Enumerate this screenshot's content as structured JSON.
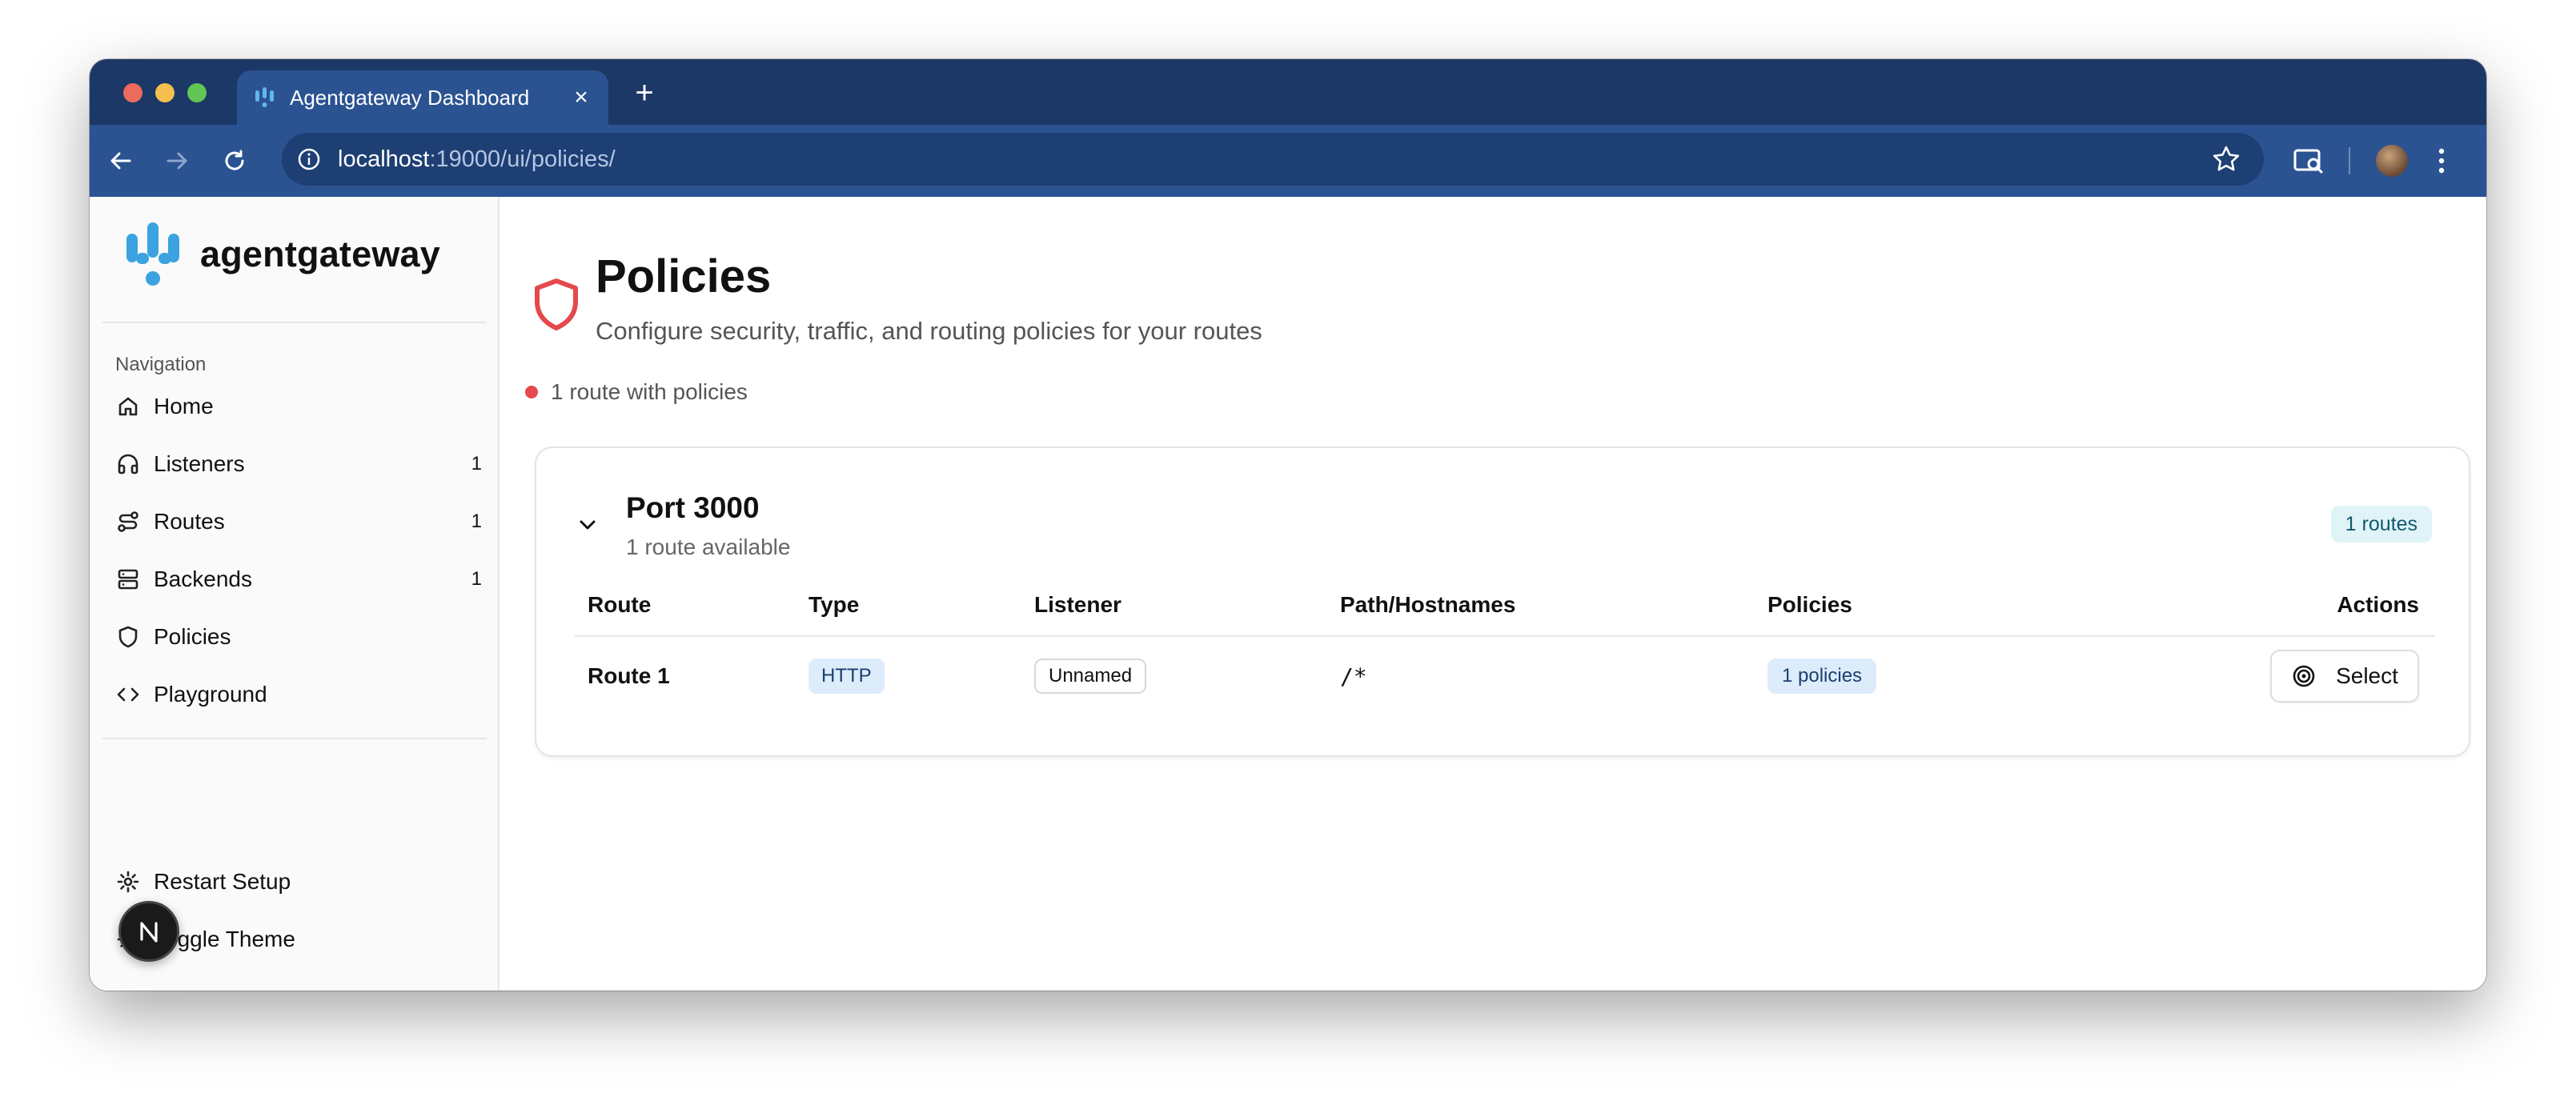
{
  "browser": {
    "tab_title": "Agentgateway Dashboard",
    "url_host": "localhost",
    "url_rest": ":19000/ui/policies/"
  },
  "sidebar": {
    "brand": "agentgateway",
    "nav_label": "Navigation",
    "items": [
      {
        "label": "Home",
        "icon": "home-icon",
        "count": ""
      },
      {
        "label": "Listeners",
        "icon": "headphones-icon",
        "count": "1"
      },
      {
        "label": "Routes",
        "icon": "route-icon",
        "count": "1"
      },
      {
        "label": "Backends",
        "icon": "server-icon",
        "count": "1"
      },
      {
        "label": "Policies",
        "icon": "shield-icon",
        "count": ""
      },
      {
        "label": "Playground",
        "icon": "code-icon",
        "count": ""
      }
    ],
    "footer": [
      {
        "label": "Restart Setup",
        "icon": "gear-icon"
      },
      {
        "label": "Toggle Theme",
        "icon": "sun-icon"
      }
    ]
  },
  "page": {
    "title": "Policies",
    "subtitle": "Configure security, traffic, and routing policies for your routes",
    "status": "1 route with policies"
  },
  "card": {
    "title": "Port 3000",
    "subtitle": "1 route available",
    "badge": "1 routes",
    "headers": {
      "route": "Route",
      "type": "Type",
      "listener": "Listener",
      "path": "Path/Hostnames",
      "policies": "Policies",
      "actions": "Actions"
    },
    "rows": [
      {
        "route": "Route 1",
        "type": "HTTP",
        "listener": "Unnamed",
        "path": "/*",
        "policies": "1 policies",
        "action": "Select"
      }
    ]
  },
  "colors": {
    "tab_strip": "#1b3866",
    "toolbar": "#2b5391",
    "brand_blue": "#3ba3e0",
    "policy_red": "#e5484d"
  }
}
